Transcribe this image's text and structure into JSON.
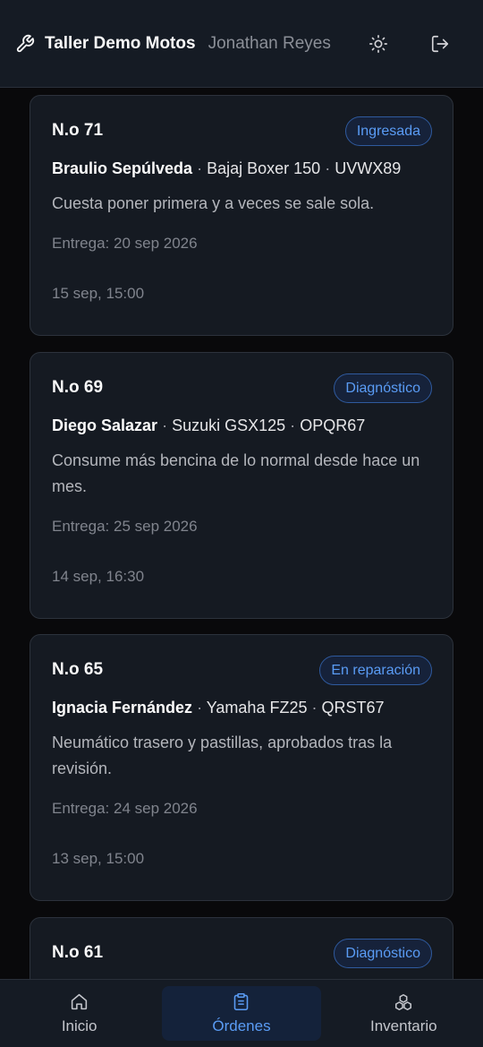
{
  "header": {
    "title": "Taller Demo Motos",
    "user": "Jonathan Reyes",
    "icons": {
      "brand": "wrench-icon",
      "theme": "sun-icon",
      "logout": "logout-icon"
    }
  },
  "orders": [
    {
      "number": "N.o 71",
      "status": "Ingresada",
      "client": "Braulio Sepúlveda",
      "bike": "Bajaj Boxer 150",
      "plate": "UVWX89",
      "description": "Cuesta poner primera y a veces se sale sola.",
      "due": "Entrega: 20 sep 2026",
      "created": "15 sep, 15:00"
    },
    {
      "number": "N.o 69",
      "status": "Diagnóstico",
      "client": "Diego Salazar",
      "bike": "Suzuki GSX125",
      "plate": "OPQR67",
      "description": "Consume más bencina de lo normal desde hace un mes.",
      "due": "Entrega: 25 sep 2026",
      "created": "14 sep, 16:30"
    },
    {
      "number": "N.o 65",
      "status": "En reparación",
      "client": "Ignacia Fernández",
      "bike": "Yamaha FZ25",
      "plate": "QRST67",
      "description": "Neumático trasero y pastillas, aprobados tras la revisión.",
      "due": "Entrega: 24 sep 2026",
      "created": "13 sep, 15:00"
    },
    {
      "number": "N.o 61",
      "status": "Diagnóstico"
    }
  ],
  "separator": "·",
  "nav": [
    {
      "label": "Inicio",
      "icon": "home-icon",
      "active": false
    },
    {
      "label": "Órdenes",
      "icon": "clipboard-icon",
      "active": true
    },
    {
      "label": "Inventario",
      "icon": "boxes-icon",
      "active": false
    }
  ],
  "colors": {
    "accent": "#5a9cf5",
    "background": "#09090b",
    "surface": "#151a22"
  }
}
